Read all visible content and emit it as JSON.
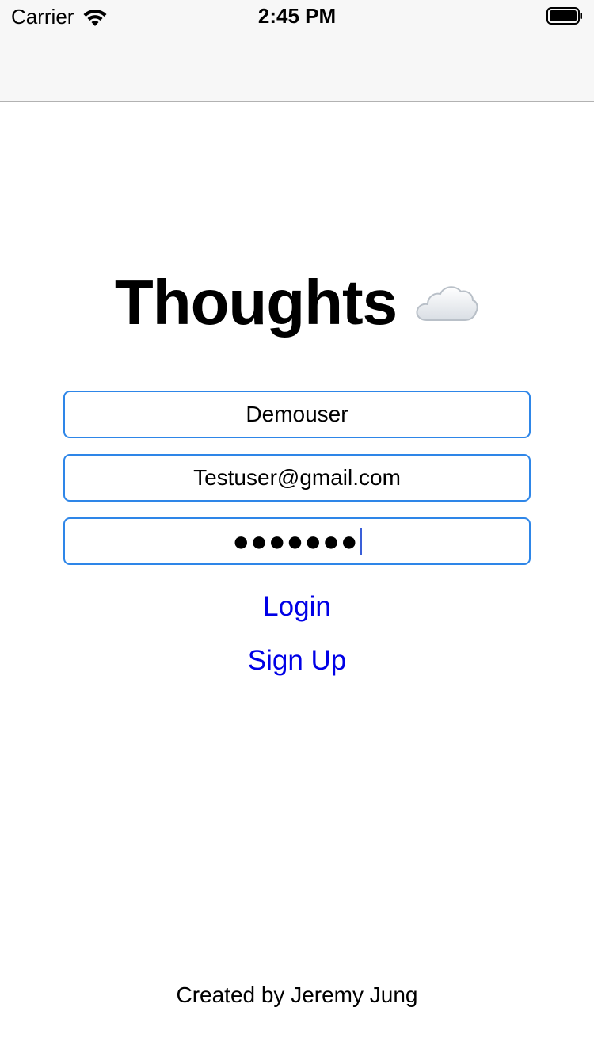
{
  "status_bar": {
    "carrier": "Carrier",
    "time": "2:45 PM"
  },
  "app": {
    "title": "Thoughts"
  },
  "form": {
    "username_value": "Demouser",
    "email_value": "Testuser@gmail.com",
    "password_masked": "●●●●●●●",
    "login_label": "Login",
    "signup_label": "Sign Up"
  },
  "footer": {
    "credit": "Created by Jeremy Jung"
  },
  "colors": {
    "field_border": "#2e86e8",
    "link": "#0000e6",
    "caret": "#3a5fd8"
  },
  "icons": {
    "status": [
      "wifi-icon",
      "battery-icon"
    ],
    "title": "cloud-icon"
  }
}
